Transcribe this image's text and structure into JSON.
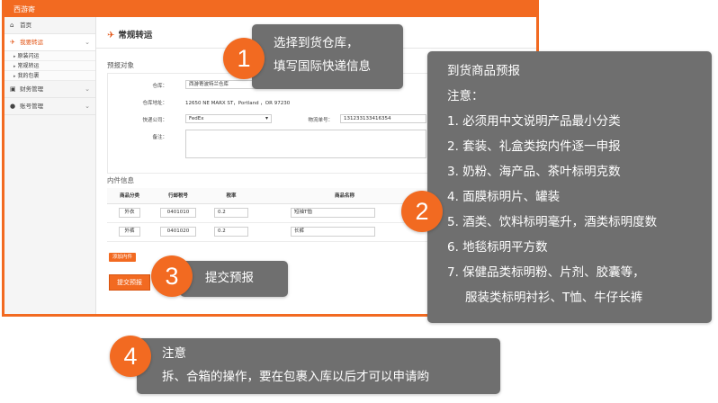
{
  "app": {
    "brand": "西游寄",
    "sidebar": {
      "items": [
        {
          "label": "首页",
          "icon": "home-icon"
        },
        {
          "label": "我要转运",
          "icon": "plane-icon"
        },
        {
          "label": "财务管理",
          "icon": "wallet-icon"
        },
        {
          "label": "账号管理",
          "icon": "user-icon"
        }
      ],
      "subitems": [
        "原装闪运",
        "常规转运",
        "我的包裹"
      ]
    },
    "page_title": "常规转运",
    "forecast": {
      "section": "预报对象",
      "warehouse_label": "仓库：",
      "warehouse_value": "西游寄波特兰仓库",
      "address_label": "仓库地址：",
      "address_value": "12650 NE MARX ST，Portland ，OR 97230",
      "courier_label": "快递公司：",
      "courier_value": "FedEx",
      "tracking_label": "物流单号：",
      "tracking_value": "131233133416354",
      "remark_label": "备注："
    },
    "items": {
      "section": "内件信息",
      "headers": [
        "商品分类",
        "行邮税号",
        "税率",
        "商品名称"
      ],
      "rows": [
        {
          "category": "外衣",
          "tax_code": "0401010",
          "rate": "0.2",
          "name": "短袖T恤"
        },
        {
          "category": "外裤",
          "tax_code": "0401020",
          "rate": "0.2",
          "name": "长裤"
        }
      ],
      "add_label": "添加内件"
    },
    "submit_label": "提交预报"
  },
  "callouts": {
    "c1": {
      "num": "1",
      "lines": [
        "选择到货仓库，",
        "填写国际快递信息"
      ]
    },
    "c2": {
      "num": "2",
      "lines": [
        "到货商品预报",
        "注意：",
        "1. 必须用中文说明产品最小分类",
        "2. 套装、礼盒类按内件逐一申报",
        "3. 奶粉、海产品、茶叶标明克数",
        "4. 面膜标明片、罐装",
        "5. 酒类、饮料标明毫升，酒类标明度数",
        "6. 地毯标明平方数",
        "7. 保健品类标明粉、片剂、胶囊等，",
        "服装类标明衬衫、T恤、牛仔长裤"
      ]
    },
    "c3": {
      "num": "3",
      "lines": [
        "提交预报"
      ]
    },
    "c4": {
      "num": "4",
      "lines": [
        "注意",
        "拆、合箱的操作，要在包裹入库以后才可以申请哟"
      ]
    }
  },
  "colors": {
    "accent": "#f26a21",
    "callout_bg": "#6f6f6f",
    "sidebar_active": "#e25313"
  }
}
